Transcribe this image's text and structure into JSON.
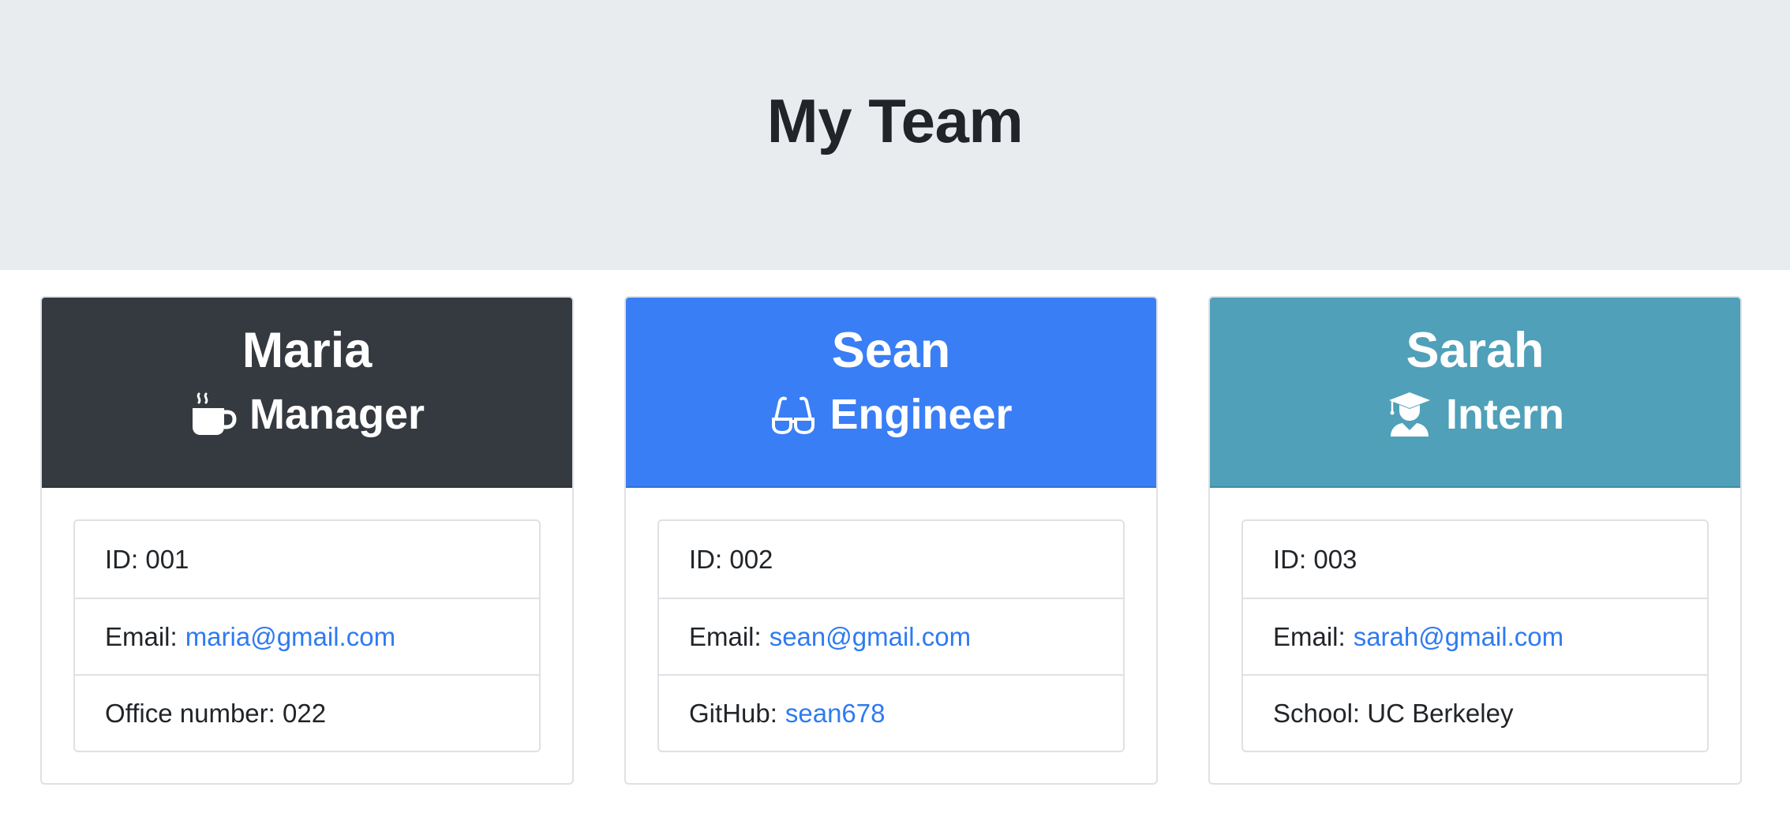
{
  "page": {
    "title": "My Team"
  },
  "colors": {
    "manager_header": "#343a40",
    "engineer_header": "#3a7ef5",
    "intern_header": "#4fa0b8",
    "link": "#2f7bf0",
    "jumbotron_bg": "#e9ecef"
  },
  "team": [
    {
      "name": "Maria",
      "role": "Manager",
      "role_icon": "coffee-mug-icon",
      "id_label": "ID: 001",
      "email_label": "Email:",
      "email": "maria@gmail.com",
      "extra_label": "Office number: 022",
      "extra_link": ""
    },
    {
      "name": "Sean",
      "role": "Engineer",
      "role_icon": "glasses-icon",
      "id_label": "ID: 002",
      "email_label": "Email:",
      "email": "sean@gmail.com",
      "extra_label": "GitHub:",
      "extra_link": "sean678"
    },
    {
      "name": "Sarah",
      "role": "Intern",
      "role_icon": "graduate-icon",
      "id_label": "ID: 003",
      "email_label": "Email:",
      "email": "sarah@gmail.com",
      "extra_label": "School: UC Berkeley",
      "extra_link": ""
    }
  ]
}
